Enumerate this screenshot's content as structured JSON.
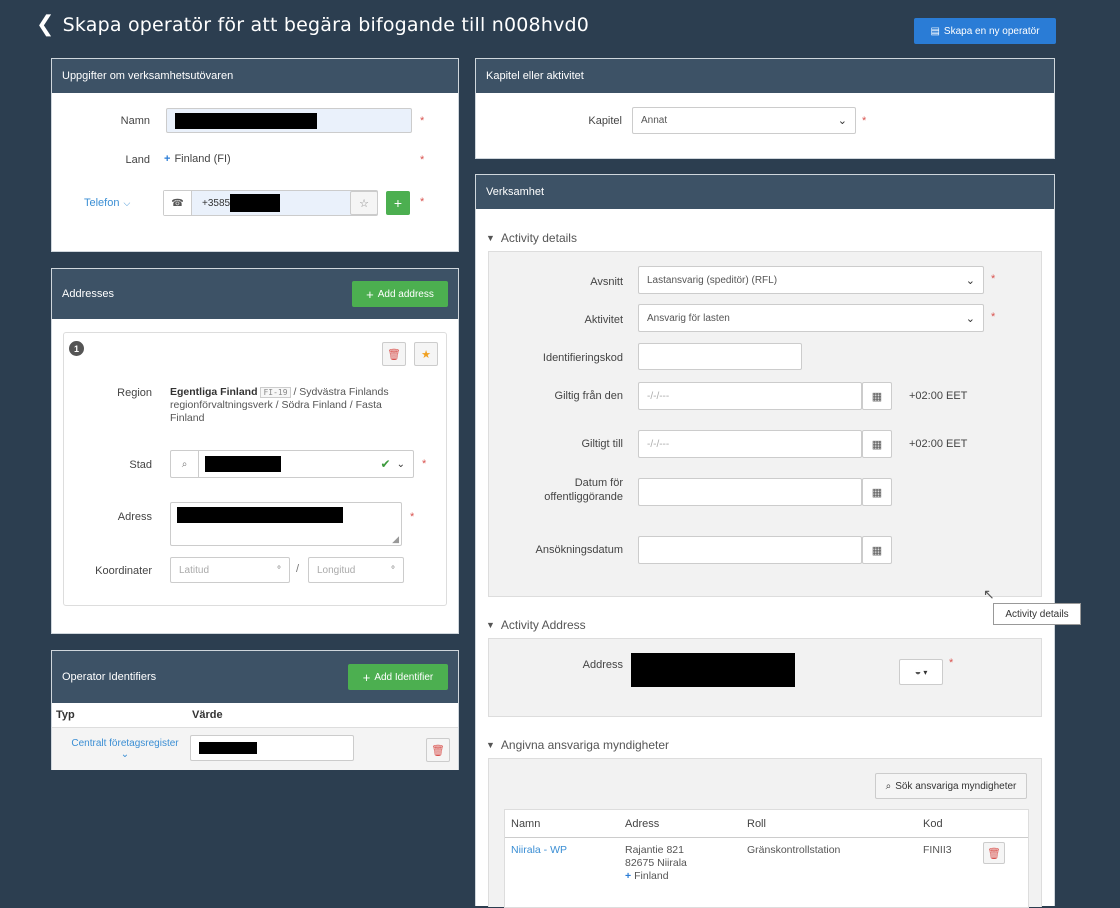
{
  "header": {
    "title": "Skapa operatör för att begära bifogande till n008hvd0",
    "new_operator_label": "Skapa en ny operatör"
  },
  "operator_details": {
    "title": "Uppgifter om verksamhetsutövaren",
    "name_label": "Namn",
    "country_label": "Land",
    "country_value": "Finland (FI)",
    "phone_type_label": "Telefon",
    "phone_prefix": "+3585",
    "required_mark": "*"
  },
  "addresses": {
    "title": "Addresses",
    "add_label": "Add address",
    "index": "1",
    "region_label": "Region",
    "region_bold": "Egentliga Finland",
    "region_code": "FI-19",
    "region_rest": "/ Sydvästra Finlands regionförvaltningsverk / Södra Finland / Fasta Finland",
    "city_label": "Stad",
    "address_label": "Adress",
    "coords_label": "Koordinater",
    "lat_placeholder": "Latitud",
    "lon_placeholder": "Longitud",
    "coord_sep": "/"
  },
  "identifiers": {
    "title": "Operator Identifiers",
    "add_label": "Add Identifier",
    "col_type": "Typ",
    "col_value": "Värde",
    "row_type": "Centralt företagsregister"
  },
  "chapter": {
    "title": "Kapitel eller aktivitet",
    "label": "Kapitel",
    "value": "Annat"
  },
  "business": {
    "title": "Verksamhet",
    "activity_details_title": "Activity details",
    "section_label": "Avsnitt",
    "section_value": "Lastansvarig (speditör) (RFL)",
    "activity_label": "Aktivitet",
    "activity_value": "Ansvarig för lasten",
    "id_code_label": "Identifieringskod",
    "valid_from_label": "Giltig från den",
    "valid_to_label": "Giltigt till",
    "date_placeholder": "-/-/---",
    "timezone": "+02:00 EET",
    "publish_date_label": "Datum för offentliggörande",
    "application_date_label": "Ansökningsdatum",
    "tooltip": "Activity details",
    "activity_address_title": "Activity Address",
    "address_label": "Address",
    "authorities_title": "Angivna ansvariga myndigheter",
    "search_authorities_label": "Sök ansvariga myndigheter",
    "table_headers": [
      "Namn",
      "Adress",
      "Roll",
      "Kod"
    ],
    "authority_row": {
      "name": "Niirala - WP",
      "address_line1": "Rajantie 821",
      "address_line2": "82675 Niirala",
      "country": "Finland",
      "role": "Gränskontrollstation",
      "code": "FINII3"
    }
  },
  "colors": {
    "primary": "#2a7cd6",
    "green": "#4caf50",
    "header": "#3d5266",
    "background": "#2c3e50",
    "required": "#d9534f"
  }
}
